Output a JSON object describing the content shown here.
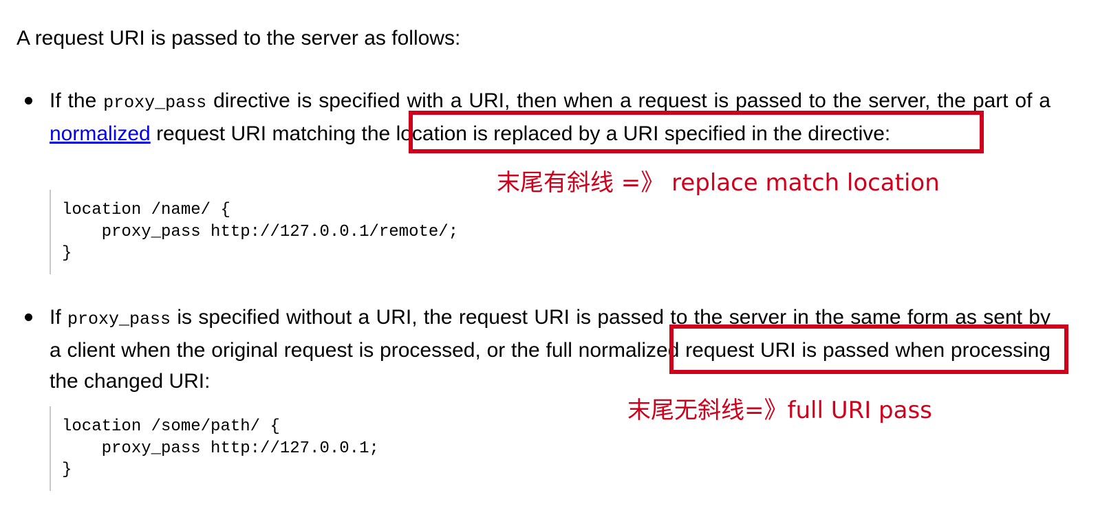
{
  "intro": "A request URI is passed to the server as follows:",
  "bullets": [
    {
      "prefix": "If the ",
      "code": "proxy_pass",
      "middle": " directive is specified with a URI, then when a request is passed to the server, the part of a ",
      "link": "normalized",
      "suffix": " request URI matching the location is replaced by a URI specified in the directive:",
      "code_block": "location /name/ {\n    proxy_pass http://127.0.0.1/remote/;\n}",
      "annotation": "末尾有斜线 =》 replace match location"
    },
    {
      "prefix": "If ",
      "code": "proxy_pass",
      "suffix": " is specified without a URI, the request URI is passed to the server in the same form as sent by a client when the original request is processed, or the full normalized request URI is passed when processing the changed URI:",
      "code_block": "location /some/path/ {\n    proxy_pass http://127.0.0.1;\n}",
      "annotation": "末尾无斜线=》full URI pass"
    }
  ],
  "colors": {
    "highlight": "#d0011b",
    "link": "#0000ee",
    "code_border": "#c8c8c8"
  }
}
